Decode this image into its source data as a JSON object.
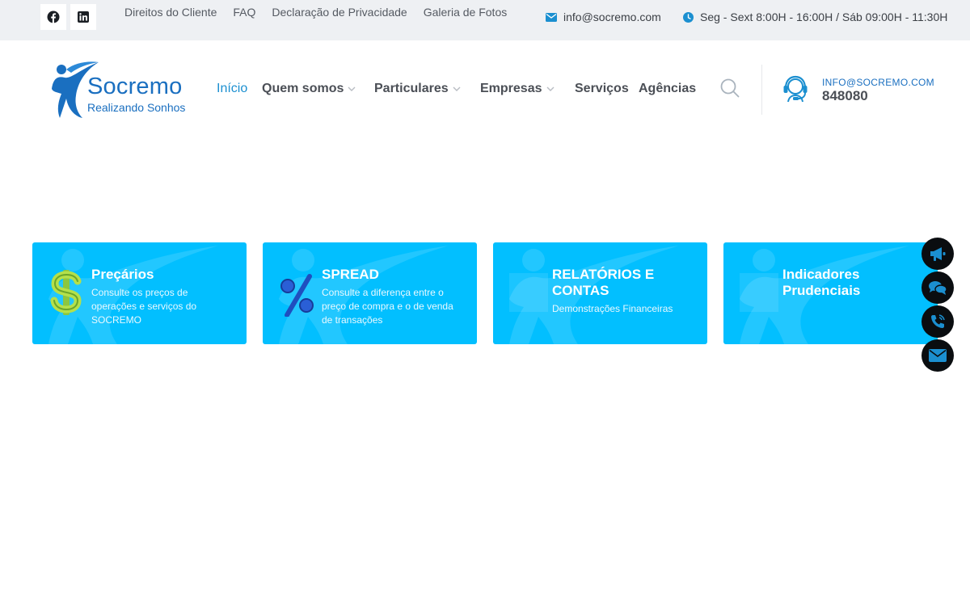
{
  "topbar": {
    "social": [
      {
        "icon": "facebook-icon"
      },
      {
        "icon": "linkedin-icon"
      }
    ],
    "links": [
      "Direitos do Cliente",
      "FAQ",
      "Declaração de Privacidade",
      "Galeria de Fotos"
    ],
    "email": "info@socremo.com",
    "hours": "Seg - Sext 8:00H - 16:00H / Sáb 09:00H - 11:30H"
  },
  "brand": {
    "name": "Socremo",
    "tagline": "Realizando Sonhos",
    "color": "#1a6fc0"
  },
  "nav": {
    "items": [
      {
        "label": "Início",
        "active": true
      },
      {
        "label": "Quem somos",
        "dropdown": true
      },
      {
        "label": "Particulares",
        "dropdown": true
      },
      {
        "label": "Empresas",
        "dropdown": true
      },
      {
        "label": "Serviços"
      },
      {
        "label": "Agências"
      }
    ],
    "accent": "#1b8fd0"
  },
  "support": {
    "email": "INFO@SOCREMO.COM",
    "phone": "848080"
  },
  "cards": [
    {
      "title": "Preçários",
      "description": "Consulte os preços de operações e serviços do SOCREMO",
      "icon": "dollar-icon"
    },
    {
      "title": "SPREAD",
      "description": "Consulte a diferença entre o preço de compra e o de venda de transações",
      "icon": "percent-icon"
    },
    {
      "title": "RELATÓRIOS E CONTAS",
      "description": "Demonstrações Financeiras"
    },
    {
      "title": "Indicadores Prudenciais",
      "description": ""
    }
  ],
  "card_color": "#02bfff",
  "floating_buttons": [
    "megaphone-icon",
    "chat-icon",
    "phone-icon",
    "envelope-icon"
  ]
}
